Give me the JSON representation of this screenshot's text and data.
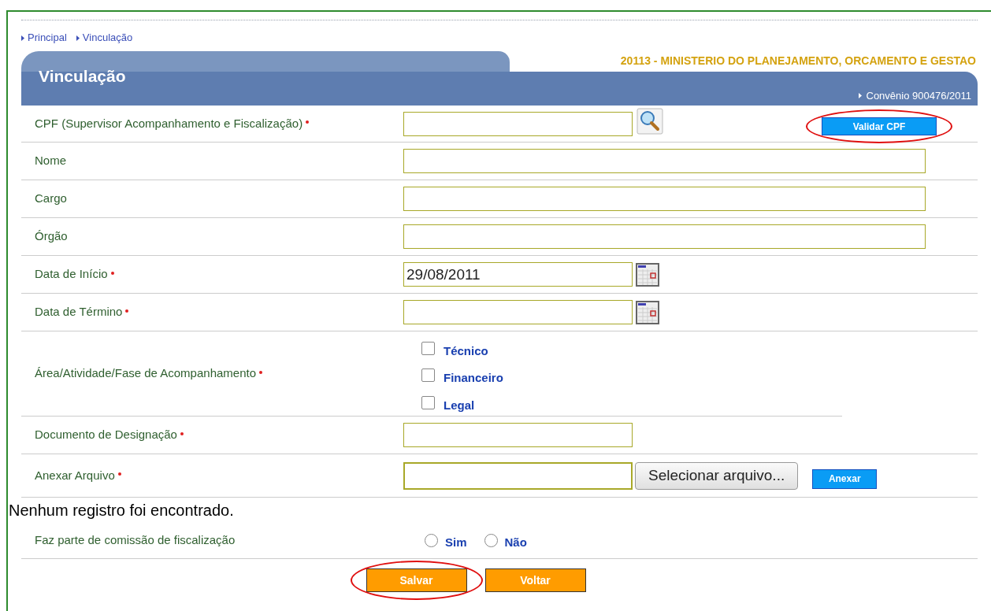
{
  "breadcrumb": [
    "Principal",
    "Vinculação"
  ],
  "header": {
    "title": "Vinculação",
    "organization": "20113 - MINISTERIO DO PLANEJAMENTO, ORCAMENTO E GESTAO",
    "agreement": "Convênio 900476/2011"
  },
  "fields": [
    {
      "kind": "cpf",
      "label": "CPF (Supervisor Acompanhamento e Fiscalização)",
      "required": true,
      "button": {
        "label": "Validar CPF",
        "highlighted": true
      }
    },
    {
      "kind": "text",
      "label": "Nome",
      "required": false
    },
    {
      "kind": "text",
      "label": "Cargo",
      "required": false
    },
    {
      "kind": "text",
      "label": "Órgão",
      "required": false
    },
    {
      "kind": "date",
      "label": "Data de Início",
      "required": true,
      "value": "29/08/2011"
    },
    {
      "kind": "date",
      "label": "Data de Término",
      "required": true
    },
    {
      "kind": "checks",
      "label": "Área/Atividade/Fase de Acompanhamento",
      "required": true,
      "options": [
        {
          "label": "Técnico",
          "checked": false
        },
        {
          "label": "Financeiro",
          "checked": false
        },
        {
          "label": "Legal",
          "checked": false
        }
      ]
    },
    {
      "kind": "short",
      "label": "Documento de Designação",
      "required": true
    },
    {
      "kind": "file",
      "label": "Anexar Arquivo",
      "required": true,
      "browse": "Selecionar arquivo...",
      "button": {
        "label": "Anexar",
        "highlighted": false
      }
    }
  ],
  "message": "Nenhum registro foi encontrado.",
  "commission": {
    "label": "Faz parte de comissão de fiscalização",
    "options": [
      {
        "label": "Sim",
        "selected": false
      },
      {
        "label": "Não",
        "selected": false
      }
    ]
  },
  "actions": [
    {
      "label": "Salvar",
      "highlighted": true
    },
    {
      "label": "Voltar",
      "highlighted": false
    }
  ]
}
